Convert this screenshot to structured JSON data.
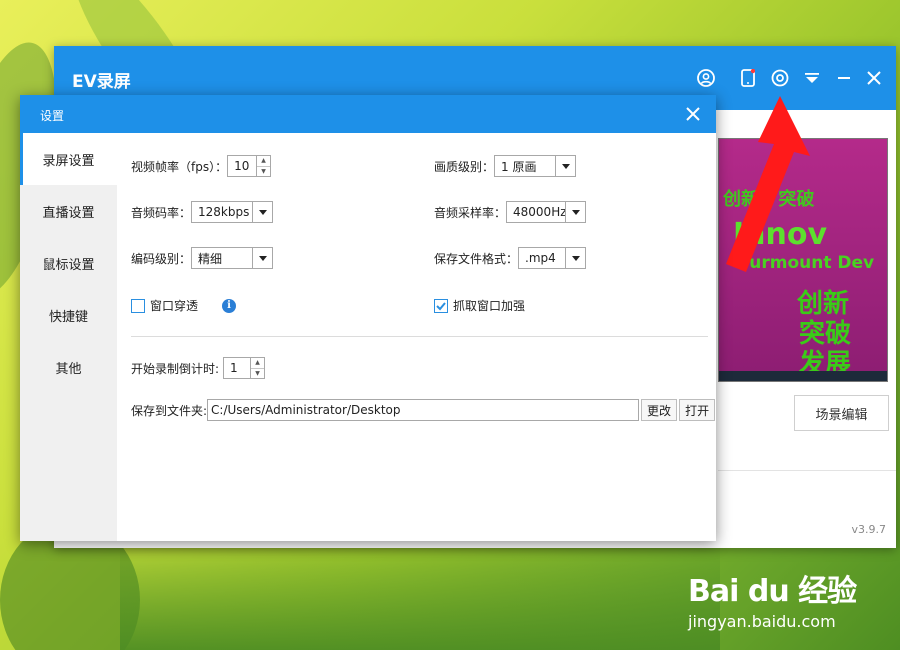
{
  "app": {
    "title": "EV录屏",
    "version": "v3.9.7",
    "scene_button": "场景编辑",
    "titlebar_icons": [
      "user-icon",
      "phone-icon",
      "settings-icon",
      "dropdown-icon",
      "minimize-icon",
      "close-icon"
    ]
  },
  "preview": {
    "lines": [
      "创新 · 突破",
      "Innov",
      "Surmount Dev",
      "创新",
      "突破",
      "发展"
    ]
  },
  "dialog": {
    "title": "设置",
    "sidebar": [
      {
        "label": "录屏设置",
        "active": true
      },
      {
        "label": "直播设置",
        "active": false
      },
      {
        "label": "鼠标设置",
        "active": false
      },
      {
        "label": "快捷键",
        "active": false
      },
      {
        "label": "其他",
        "active": false
      }
    ],
    "fps": {
      "label": "视频帧率（fps）：",
      "value": "10"
    },
    "quality": {
      "label": "画质级别：",
      "value": "1 原画"
    },
    "audio_bitrate": {
      "label": "音频码率：",
      "value": "128kbps"
    },
    "sample_rate": {
      "label": "音频采样率：",
      "value": "48000Hz"
    },
    "encode_level": {
      "label": "编码级别：",
      "value": "精细"
    },
    "file_format": {
      "label": "保存文件格式：",
      "value": ".mp4"
    },
    "window_through": {
      "label": "窗口穿透",
      "checked": false
    },
    "capture_enhance": {
      "label": "抓取窗口加强",
      "checked": true
    },
    "countdown": {
      "label": "开始录制倒计时:",
      "value": "1"
    },
    "save_folder": {
      "label": "保存到文件夹:",
      "value": "C:/Users/Administrator/Desktop",
      "change_label": "更改",
      "open_label": "打开"
    }
  },
  "watermark": {
    "logo": "Bai du 经验",
    "url": "jingyan.baidu.com"
  },
  "colors": {
    "accent": "#1e90e8",
    "annotation_arrow": "#ff1a1a",
    "checkbox": "#2a8fe0"
  }
}
